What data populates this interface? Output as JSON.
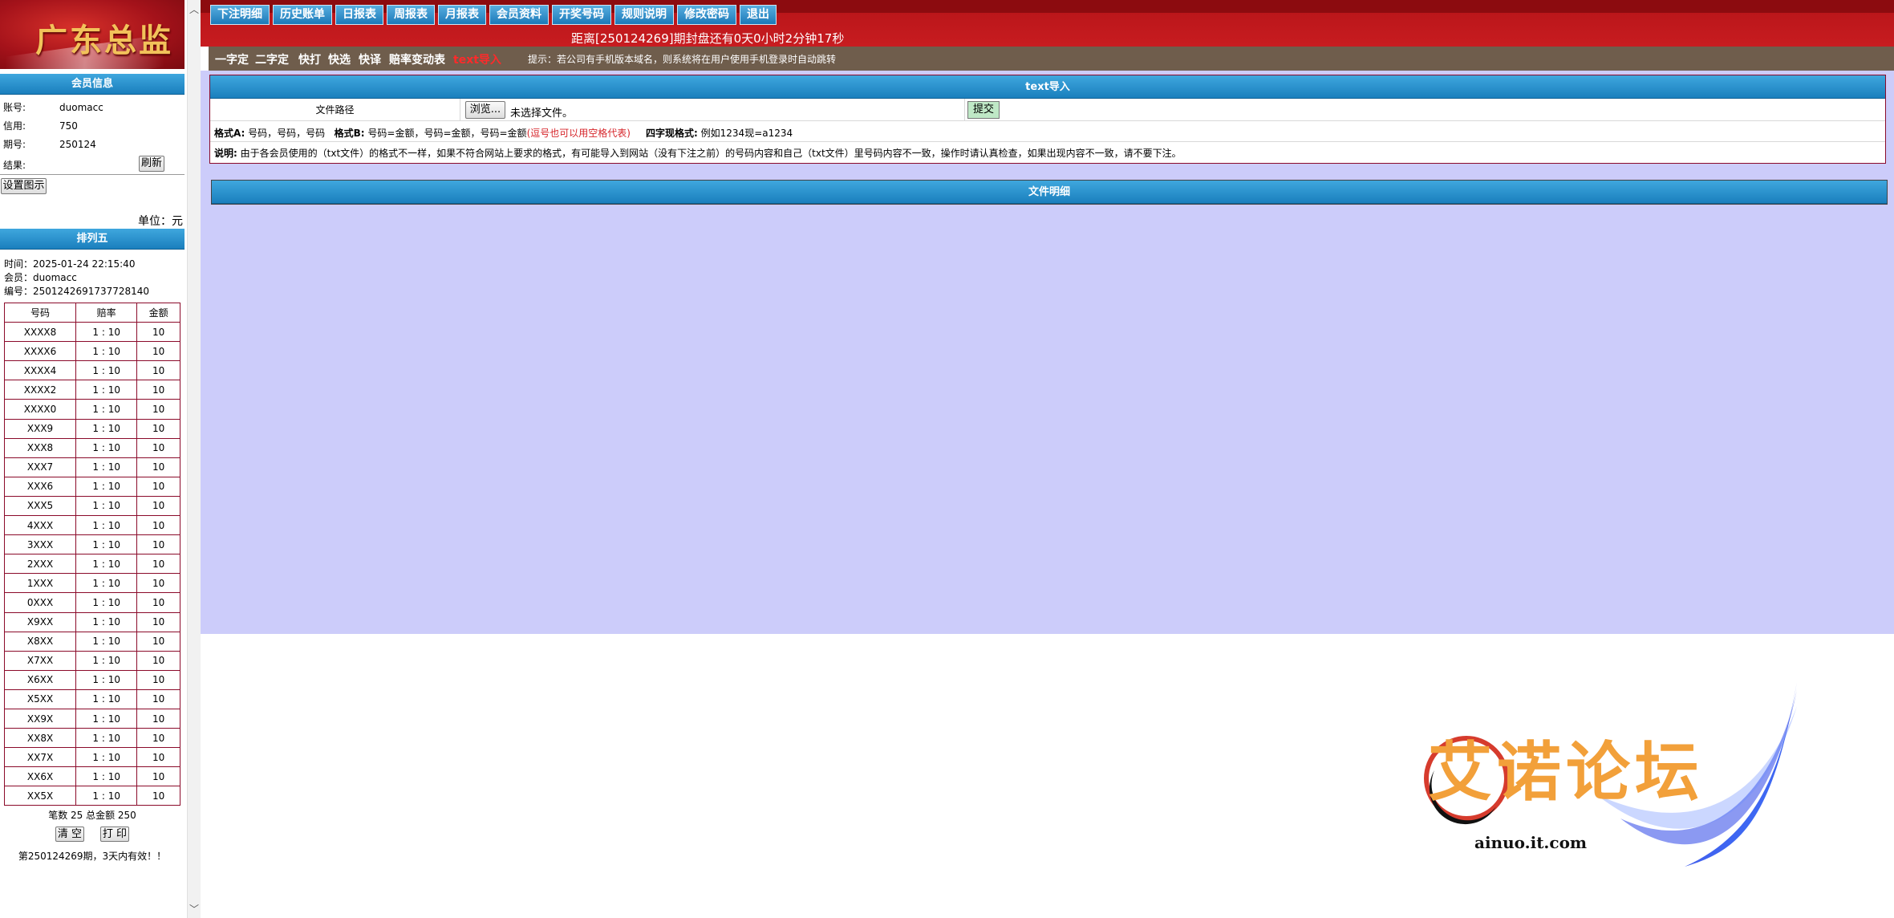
{
  "logo": {
    "title": "广东总监"
  },
  "member": {
    "header": "会员信息",
    "account_label": "账号:",
    "account": "duomacc",
    "credit_label": "信用:",
    "credit": "750",
    "period_label": "期号:",
    "period": "250124",
    "result_label": "结果:",
    "refresh": "刷新",
    "settings_button": "设置图示",
    "unit": "单位：元"
  },
  "ticket": {
    "header": "排列五",
    "time": "时间：2025-01-24 22:15:40",
    "member": "会员：duomacc",
    "number": "编号：2501242691737728140",
    "columns": [
      "号码",
      "赔率",
      "金额"
    ],
    "rows": [
      [
        "XXXX8",
        "1 : 10",
        "10"
      ],
      [
        "XXXX6",
        "1 : 10",
        "10"
      ],
      [
        "XXXX4",
        "1 : 10",
        "10"
      ],
      [
        "XXXX2",
        "1 : 10",
        "10"
      ],
      [
        "XXXX0",
        "1 : 10",
        "10"
      ],
      [
        "XXX9",
        "1 : 10",
        "10"
      ],
      [
        "XXX8",
        "1 : 10",
        "10"
      ],
      [
        "XXX7",
        "1 : 10",
        "10"
      ],
      [
        "XXX6",
        "1 : 10",
        "10"
      ],
      [
        "XXX5",
        "1 : 10",
        "10"
      ],
      [
        "4XXX",
        "1 : 10",
        "10"
      ],
      [
        "3XXX",
        "1 : 10",
        "10"
      ],
      [
        "2XXX",
        "1 : 10",
        "10"
      ],
      [
        "1XXX",
        "1 : 10",
        "10"
      ],
      [
        "0XXX",
        "1 : 10",
        "10"
      ],
      [
        "X9XX",
        "1 : 10",
        "10"
      ],
      [
        "X8XX",
        "1 : 10",
        "10"
      ],
      [
        "X7XX",
        "1 : 10",
        "10"
      ],
      [
        "X6XX",
        "1 : 10",
        "10"
      ],
      [
        "X5XX",
        "1 : 10",
        "10"
      ],
      [
        "XX9X",
        "1 : 10",
        "10"
      ],
      [
        "XX8X",
        "1 : 10",
        "10"
      ],
      [
        "XX7X",
        "1 : 10",
        "10"
      ],
      [
        "XX6X",
        "1 : 10",
        "10"
      ],
      [
        "XX5X",
        "1 : 10",
        "10"
      ]
    ],
    "summary": "笔数 25 总金额 250",
    "clear": "清 空",
    "print": "打 印",
    "valid_note": "第250124269期，3天内有效！！"
  },
  "nav": [
    "下注明细",
    "历史账单",
    "日报表",
    "周报表",
    "月报表",
    "会员资料",
    "开奖号码",
    "规则说明",
    "修改密码",
    "退出"
  ],
  "countdown": "距离[250124269]期封盘还有0天0小时2分钟17秒",
  "subnav": {
    "items": [
      "一字定",
      "二字定",
      "快打",
      "快选",
      "快译",
      "赔率变动表",
      "text导入"
    ],
    "tip": "提示：若公司有手机版本域名，则系统将在用户使用手机登录时自动跳转"
  },
  "import": {
    "header": "text导入",
    "file_path_label": "文件路径",
    "browse": "浏览...",
    "no_file": "未选择文件。",
    "submit": "提交",
    "fmt_a_label": "格式A:",
    "fmt_a": "号码，号码，号码",
    "fmt_b_label": "格式B:",
    "fmt_b": "号码=金额，号码=金额，号码=金额",
    "fmt_b_note": "(逗号也可以用空格代表)",
    "fmt_4_label": "四字现格式:",
    "fmt_4": "例如1234现=a1234",
    "note_label": "说明:",
    "note": "由于各会员使用的（txt文件）的格式不一样，如果不符合网站上要求的格式，有可能导入到网站（没有下注之前）的号码内容和自己（txt文件）里号码内容不一致，操作时请认真检查，如果出现内容不一致，请不要下注。"
  },
  "detail": {
    "header": "文件明细"
  },
  "watermark": {
    "text": "艾诺论坛",
    "url": "ainuo.it.com"
  }
}
